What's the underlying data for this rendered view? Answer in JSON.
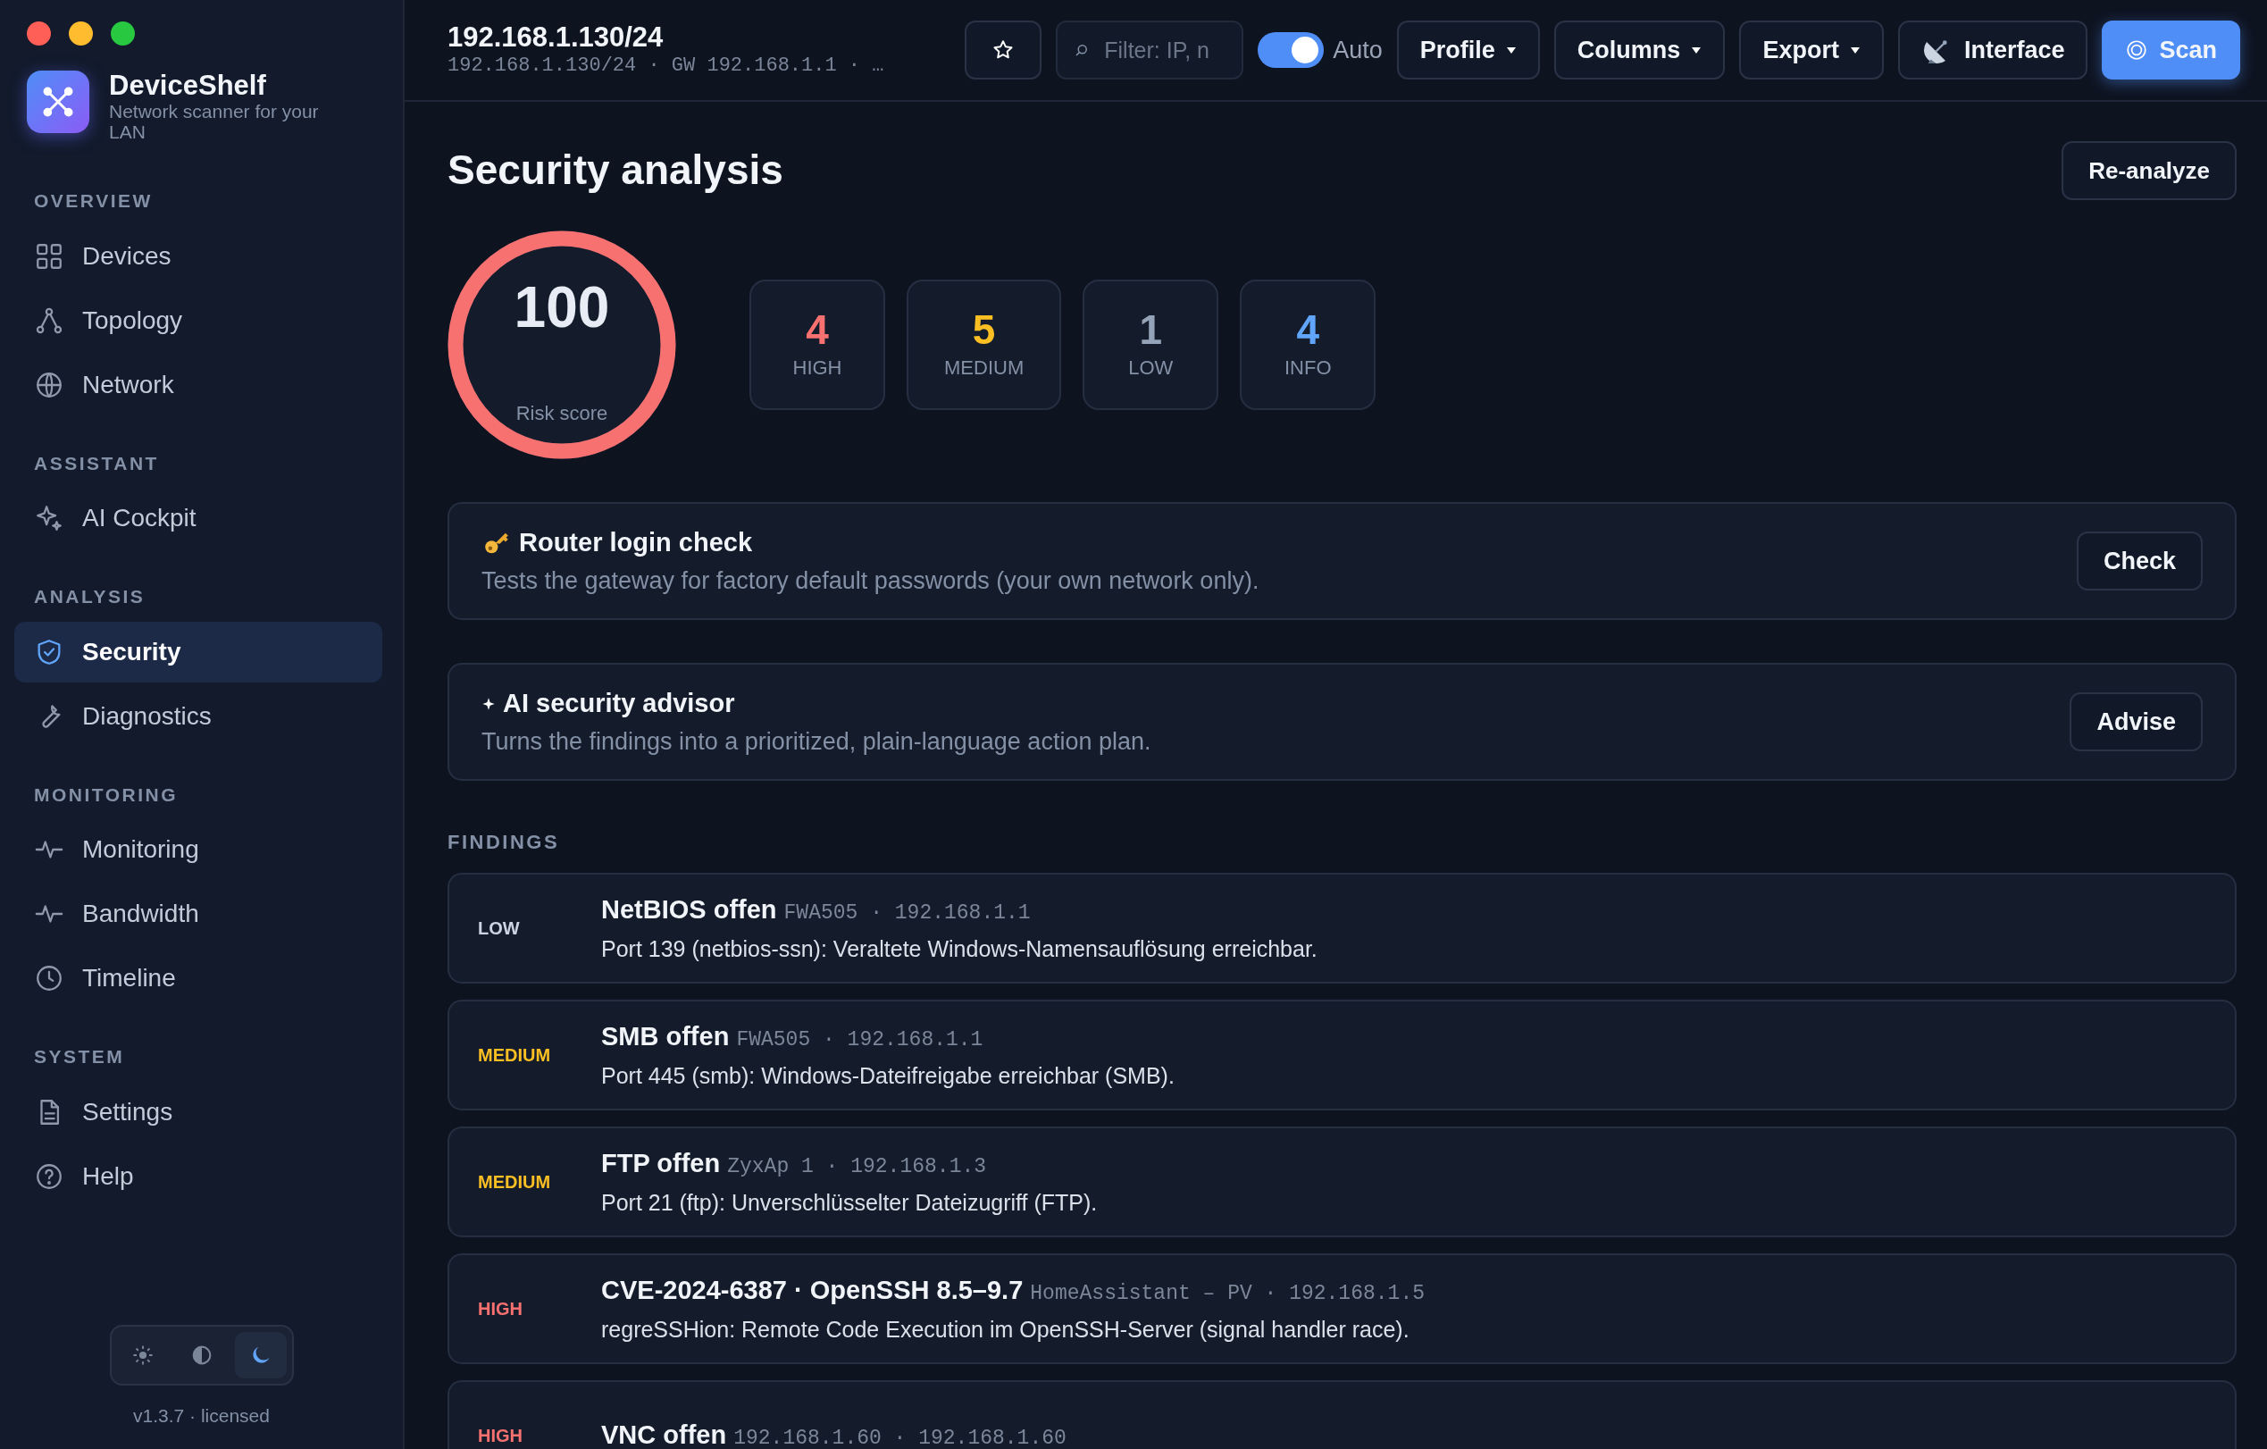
{
  "window_controls": [
    {
      "color": "#ff5f57"
    },
    {
      "color": "#febc2e"
    },
    {
      "color": "#28c840"
    }
  ],
  "app": {
    "name": "DeviceShelf",
    "tagline": "Network scanner for your LAN"
  },
  "sidebar": {
    "sections": [
      {
        "title": "OVERVIEW",
        "items": [
          {
            "label": "Devices",
            "selected": false
          },
          {
            "label": "Topology",
            "selected": false
          },
          {
            "label": "Network",
            "selected": false
          }
        ]
      },
      {
        "title": "ASSISTANT",
        "items": [
          {
            "label": "AI Cockpit",
            "selected": false
          }
        ]
      },
      {
        "title": "ANALYSIS",
        "items": [
          {
            "label": "Security",
            "selected": true
          },
          {
            "label": "Diagnostics",
            "selected": false
          }
        ]
      },
      {
        "title": "MONITORING",
        "items": [
          {
            "label": "Monitoring",
            "selected": false
          },
          {
            "label": "Bandwidth",
            "selected": false
          },
          {
            "label": "Timeline",
            "selected": false
          }
        ]
      },
      {
        "title": "SYSTEM",
        "items": [
          {
            "label": "Settings",
            "selected": false
          },
          {
            "label": "Help",
            "selected": false
          }
        ]
      }
    ]
  },
  "theme_switch": [
    {
      "selected": false
    },
    {
      "selected": false
    },
    {
      "selected": true
    }
  ],
  "version": "v1.3.7 · licensed",
  "topbar": {
    "title": "192.168.1.130/24",
    "subtitle": "192.168.1.130/24 · GW 192.168.1.1 · …",
    "filter": {
      "placeholder": "Filter: IP, n"
    },
    "auto": {
      "label": "Auto",
      "on": true
    },
    "buttons": [
      {
        "label": "Profile",
        "kind": "dropdown"
      },
      {
        "label": "Columns",
        "kind": "dropdown"
      },
      {
        "label": "Export",
        "kind": "dropdown"
      },
      {
        "label": "Interface",
        "kind": "dish"
      },
      {
        "label": "Scan",
        "kind": "primary"
      }
    ]
  },
  "page": {
    "title": "Security analysis",
    "reanalyze": "Re-analyze",
    "risk": {
      "score": "100",
      "label": "Risk score",
      "level": 1
    },
    "counts": [
      {
        "value": "4",
        "label": "HIGH",
        "color": "#f87171"
      },
      {
        "value": "5",
        "label": "MEDIUM",
        "color": "#fbbf24"
      },
      {
        "value": "1",
        "label": "LOW",
        "color": "#94a3b8"
      },
      {
        "value": "4",
        "label": "INFO",
        "color": "#60a5fa"
      }
    ],
    "actions": [
      {
        "kind": "key",
        "title": "Router login check",
        "description": "Tests the gateway for factory default passwords (your own network only).",
        "button": "Check"
      },
      {
        "kind": "sparkle",
        "title": "AI security advisor",
        "description": "Turns the findings into a prioritized, plain-language action plan.",
        "button": "Advise"
      }
    ],
    "findings": {
      "title": "FINDINGS",
      "items": [
        {
          "severity": "LOW",
          "color": "#cbd5e1",
          "title": "NetBIOS offen",
          "meta": "FWA505 · 192.168.1.1",
          "description": "Port 139 (netbios-ssn): Veraltete Windows-Namensauflösung erreichbar."
        },
        {
          "severity": "MEDIUM",
          "color": "#fbbf24",
          "title": "SMB offen",
          "meta": "FWA505 · 192.168.1.1",
          "description": "Port 445 (smb): Windows-Dateifreigabe erreichbar (SMB)."
        },
        {
          "severity": "MEDIUM",
          "color": "#fbbf24",
          "title": "FTP offen",
          "meta": "ZyxAp 1 · 192.168.1.3",
          "description": "Port 21 (ftp): Unverschlüsselter Dateizugriff (FTP)."
        },
        {
          "severity": "HIGH",
          "color": "#f87171",
          "title": "CVE-2024-6387 · OpenSSH 8.5–9.7",
          "meta": "HomeAssistant – PV · 192.168.1.5",
          "description": "regreSSHion: Remote Code Execution im OpenSSH-Server (signal handler race)."
        },
        {
          "severity": "HIGH",
          "color": "#f87171",
          "title": "VNC offen",
          "meta": "192.168.1.60 · 192.168.1.60"
        }
      ]
    }
  }
}
